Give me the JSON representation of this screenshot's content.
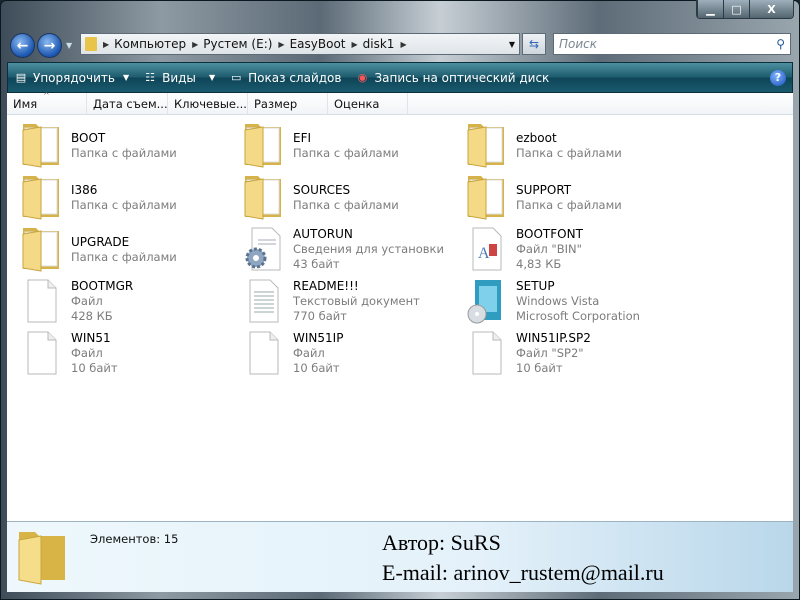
{
  "window": {
    "minimize": "▁",
    "maximize": "□",
    "close": "X"
  },
  "address": {
    "crumbs": [
      "Компьютер",
      "Рустем (E:)",
      "EasyBoot",
      "disk1"
    ],
    "search_placeholder": "Поиск"
  },
  "toolbar": {
    "organize": "Упорядочить",
    "views": "Виды",
    "slideshow": "Показ слайдов",
    "burn": "Запись на оптический диск",
    "help": "?"
  },
  "columns": [
    "Имя",
    "Дата съем...",
    "Ключевые...",
    "Размер",
    "Оценка"
  ],
  "items": [
    {
      "name": "BOOT",
      "l1": "Папка с файлами",
      "l2": "",
      "icon": "folder"
    },
    {
      "name": "EFI",
      "l1": "Папка с файлами",
      "l2": "",
      "icon": "folder"
    },
    {
      "name": "ezboot",
      "l1": "Папка с файлами",
      "l2": "",
      "icon": "folder"
    },
    {
      "name": "I386",
      "l1": "Папка с файлами",
      "l2": "",
      "icon": "folder"
    },
    {
      "name": "SOURCES",
      "l1": "Папка с файлами",
      "l2": "",
      "icon": "folder"
    },
    {
      "name": "SUPPORT",
      "l1": "Папка с файлами",
      "l2": "",
      "icon": "folder"
    },
    {
      "name": "UPGRADE",
      "l1": "Папка с файлами",
      "l2": "",
      "icon": "folder"
    },
    {
      "name": "AUTORUN",
      "l1": "Сведения для установки",
      "l2": "43 байт",
      "icon": "settings"
    },
    {
      "name": "BOOTFONT",
      "l1": "Файл \"BIN\"",
      "l2": "4,83 КБ",
      "icon": "font"
    },
    {
      "name": "BOOTMGR",
      "l1": "Файл",
      "l2": "428 КБ",
      "icon": "file"
    },
    {
      "name": "README!!!",
      "l1": "Текстовый документ",
      "l2": "770 байт",
      "icon": "text"
    },
    {
      "name": "SETUP",
      "l1": "Windows Vista",
      "l2": "Microsoft Corporation",
      "icon": "setup"
    },
    {
      "name": "WIN51",
      "l1": "Файл",
      "l2": "10 байт",
      "icon": "file"
    },
    {
      "name": "WIN51IP",
      "l1": "Файл",
      "l2": "10 байт",
      "icon": "file"
    },
    {
      "name": "WIN51IP.SP2",
      "l1": "Файл \"SP2\"",
      "l2": "10 байт",
      "icon": "file"
    }
  ],
  "details": {
    "count": "Элементов: 15"
  },
  "credits": {
    "author": "Автор: SuRS",
    "email": "E-mail: arinov_rustem@mail.ru"
  }
}
